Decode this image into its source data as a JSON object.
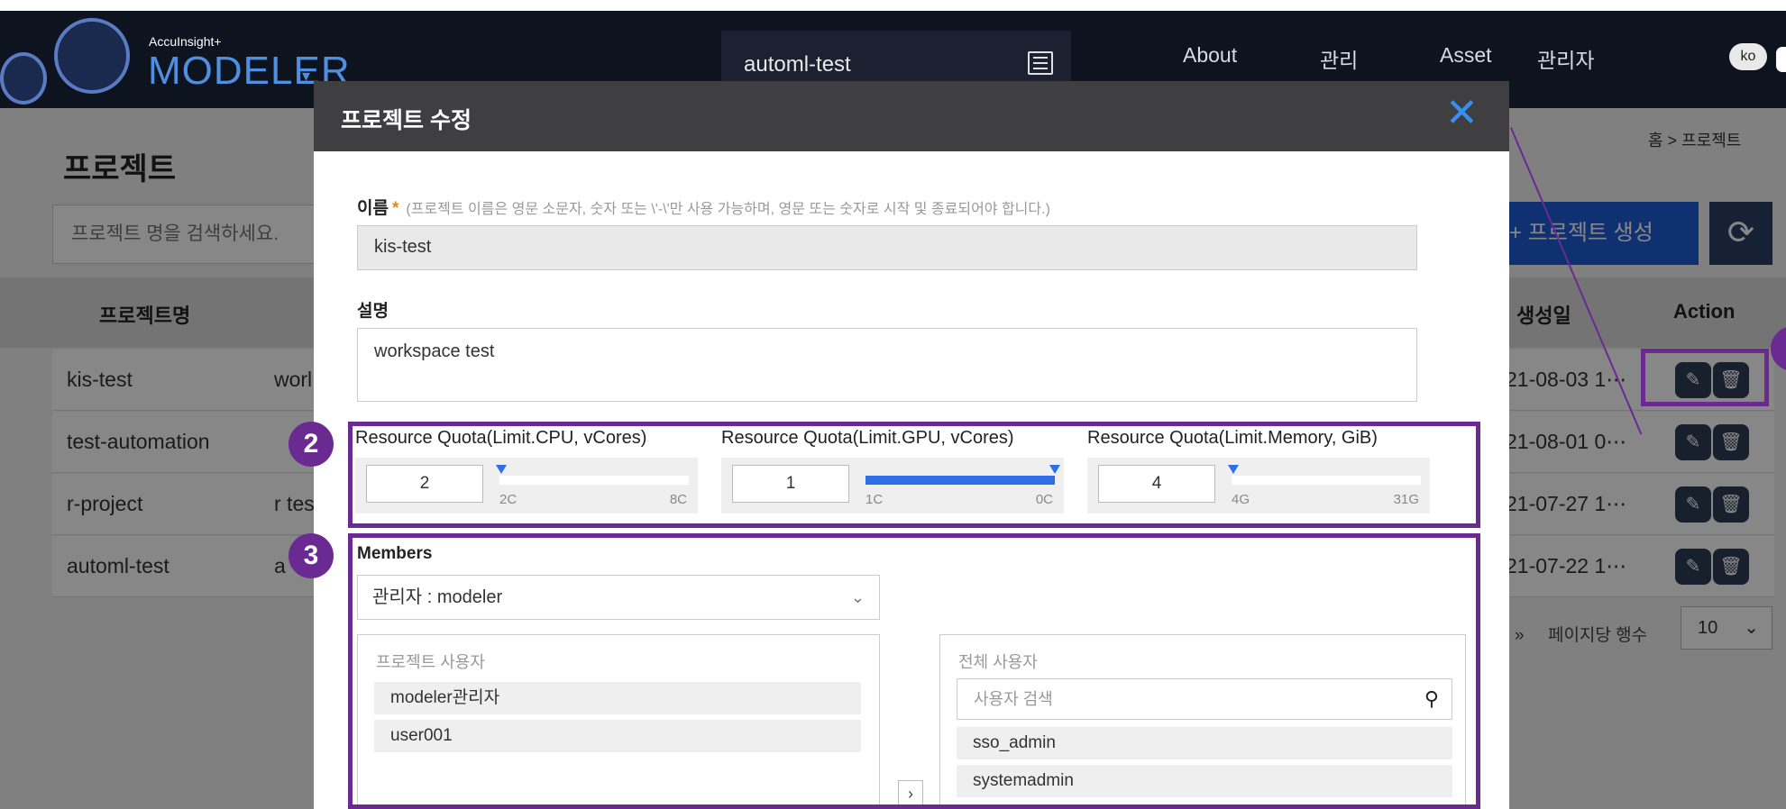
{
  "header": {
    "logo_sub": "AccuInsight+",
    "logo_main": "MODELER",
    "project_selector": "automl-test",
    "nav": [
      "About",
      "관리",
      "Asset",
      "관리자"
    ],
    "lang": "ko"
  },
  "page": {
    "title": "프로젝트",
    "breadcrumb": "홈 > 프로젝트",
    "search_placeholder": "프로젝트 명을 검색하세요.",
    "create_button": "+ 프로젝트 생성",
    "columns": {
      "name": "프로젝트명",
      "created": "생성일",
      "action": "Action"
    },
    "rows": [
      {
        "name": "kis-test",
        "desc": "worl",
        "date": "21-08-03 1⋯"
      },
      {
        "name": "test-automation",
        "desc": "",
        "date": "21-08-01 0⋯"
      },
      {
        "name": "r-project",
        "desc": "r tes",
        "date": "21-07-27 1⋯"
      },
      {
        "name": "automl-test",
        "desc": "a",
        "date": "21-07-22 1⋯"
      }
    ],
    "rows_per_page_label": "페이지당 행수",
    "rows_per_page": "10"
  },
  "modal": {
    "title": "프로젝트 수정",
    "name_label": "이름",
    "name_required": "*",
    "name_hint": "(프로젝트 이름은 영문 소문자, 숫자 또는 \\'-\\'만 사용 가능하며, 영문 또는 숫자로 시작 및 종료되어야 합니다.)",
    "name_value": "kis-test",
    "desc_label": "설명",
    "desc_value": "workspace test",
    "quotas": [
      {
        "label": "Resource Quota(Limit.CPU, vCores)",
        "value": "2",
        "min": "2C",
        "max": "8C",
        "level": 0.0
      },
      {
        "label": "Resource Quota(Limit.GPU, vCores)",
        "value": "1",
        "min": "1C",
        "max": "0C",
        "level": 1.0
      },
      {
        "label": "Resource Quota(Limit.Memory, GiB)",
        "value": "4",
        "min": "4G",
        "max": "31G",
        "level": 0.0
      }
    ],
    "members_label": "Members",
    "members_select": "관리자 : modeler",
    "project_users_label": "프로젝트 사용자",
    "project_users": [
      "modeler관리자",
      "user001"
    ],
    "all_users_label": "전체 사용자",
    "user_search_placeholder": "사용자 검색",
    "all_users": [
      "sso_admin",
      "systemadmin"
    ]
  },
  "annotations": [
    "2",
    "3"
  ],
  "colors": {
    "accent": "#6a2a92",
    "primary": "#1e5ed8",
    "slider": "#2e6ee8",
    "close": "#3a8ef0"
  }
}
